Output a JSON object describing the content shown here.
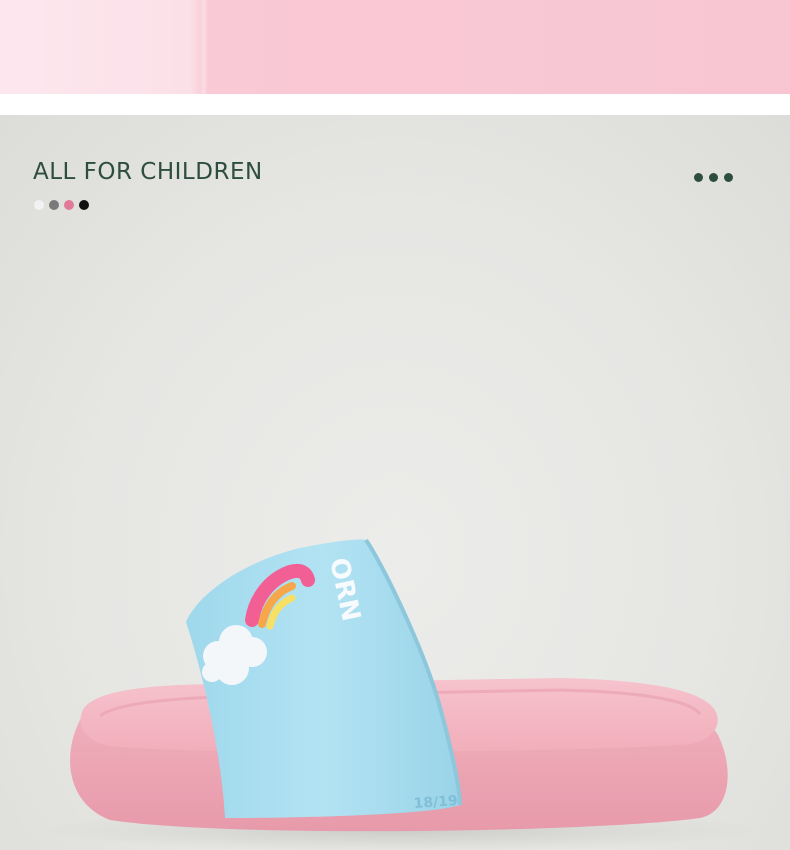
{
  "header": {
    "title": "ALL FOR CHILDREN"
  },
  "swatches": [
    {
      "name": "white-swatch",
      "color": "#f2f2f2"
    },
    {
      "name": "grey-swatch",
      "color": "#7a7a7a"
    },
    {
      "name": "pink-swatch",
      "color": "#e07a98"
    },
    {
      "name": "black-swatch",
      "color": "#111111"
    }
  ],
  "more_icon": "more-horizontal-icon",
  "product": {
    "strap_text": "ORN",
    "size_label": "18/19"
  },
  "colors": {
    "accent": "#2e4d41",
    "sole": "#f4b7c2",
    "strap": "#a9def0"
  }
}
